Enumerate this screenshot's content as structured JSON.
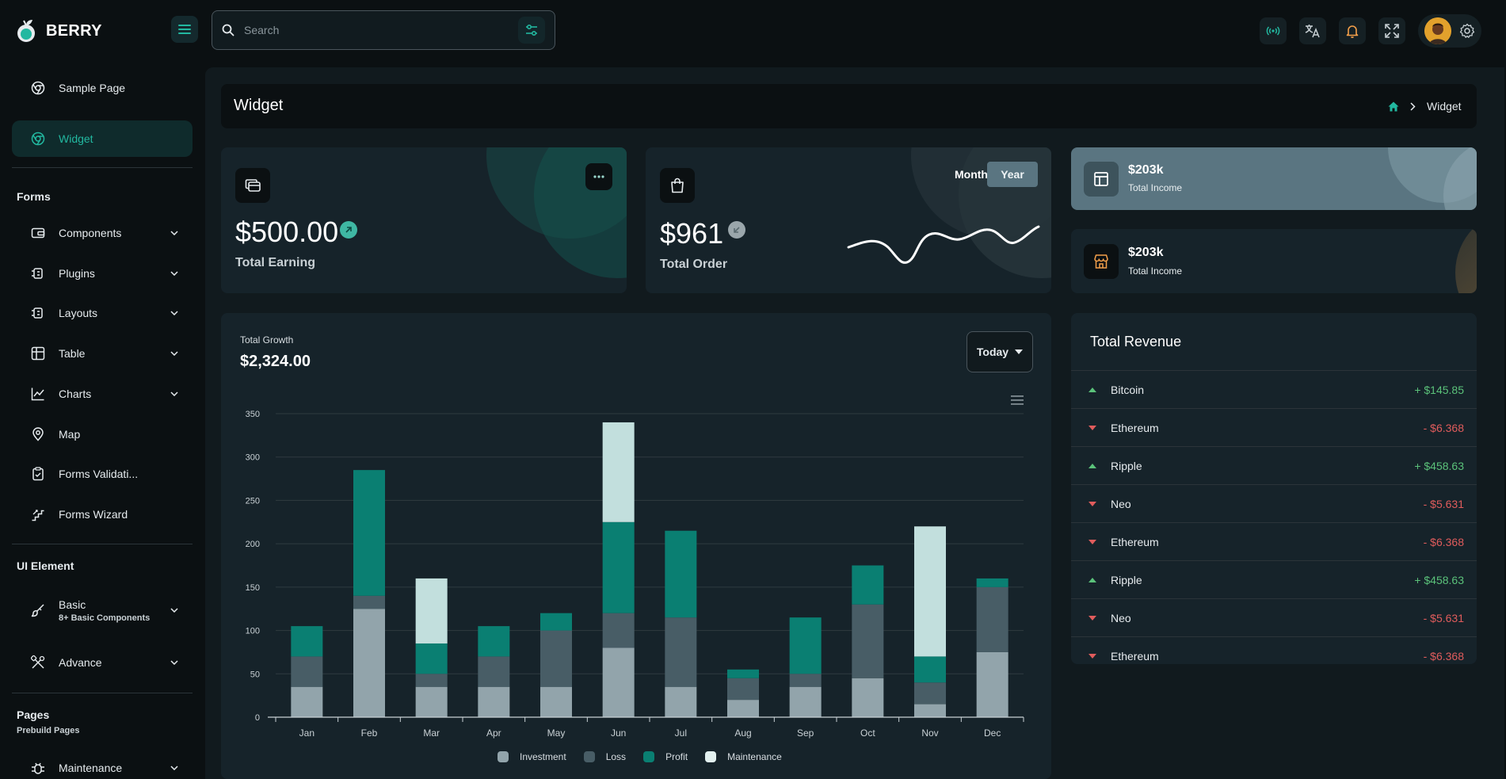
{
  "app": {
    "name": "BERRY"
  },
  "search": {
    "placeholder": "Search"
  },
  "sidebar": {
    "items_top": [
      {
        "label": "Sample Page"
      },
      {
        "label": "Widget"
      }
    ],
    "forms_title": "Forms",
    "forms_items": [
      {
        "label": "Components"
      },
      {
        "label": "Plugins"
      },
      {
        "label": "Layouts"
      },
      {
        "label": "Table"
      },
      {
        "label": "Charts"
      },
      {
        "label": "Map"
      },
      {
        "label": "Forms Validati..."
      },
      {
        "label": "Forms Wizard"
      }
    ],
    "ui_title": "UI Element",
    "basic": {
      "label": "Basic",
      "caption": "8+ Basic Components"
    },
    "advance": {
      "label": "Advance"
    },
    "pages_title": "Pages",
    "pages_caption": "Prebuild Pages",
    "maintenance": {
      "label": "Maintenance"
    }
  },
  "page": {
    "title": "Widget",
    "breadcrumb_current": "Widget"
  },
  "earning": {
    "amount": "$500.00",
    "label": "Total Earning"
  },
  "order": {
    "amount": "$961",
    "label": "Total Order",
    "tab_month": "Month",
    "tab_year": "Year",
    "active_tab": "Year"
  },
  "income_cards": [
    {
      "amount": "$203k",
      "label": "Total Income"
    },
    {
      "amount": "$203k",
      "label": "Total Income"
    }
  ],
  "growth": {
    "caption": "Total Growth",
    "amount": "$2,324.00",
    "period": "Today"
  },
  "revenue": {
    "title": "Total Revenue",
    "rows": [
      {
        "name": "Bitcoin",
        "value": "+ $145.85",
        "trend": "up"
      },
      {
        "name": "Ethereum",
        "value": "- $6.368",
        "trend": "down"
      },
      {
        "name": "Ripple",
        "value": "+ $458.63",
        "trend": "up"
      },
      {
        "name": "Neo",
        "value": "- $5.631",
        "trend": "down"
      },
      {
        "name": "Ethereum",
        "value": "- $6.368",
        "trend": "down"
      },
      {
        "name": "Ripple",
        "value": "+ $458.63",
        "trend": "up"
      },
      {
        "name": "Neo",
        "value": "- $5.631",
        "trend": "down"
      },
      {
        "name": "Ethereum",
        "value": "- $6.368",
        "trend": "down"
      }
    ]
  },
  "colors": {
    "accent": "#22b8a0",
    "investment": "#92a4ab",
    "loss": "#485d66",
    "profit": "#0a7f72",
    "maintenance": "#c2dfdd",
    "up": "#5bc27a",
    "down": "#e05c5c"
  },
  "chart_data": {
    "type": "bar",
    "stacked": true,
    "categories": [
      "Jan",
      "Feb",
      "Mar",
      "Apr",
      "May",
      "Jun",
      "Jul",
      "Aug",
      "Sep",
      "Oct",
      "Nov",
      "Dec"
    ],
    "ylim": [
      0,
      350
    ],
    "yticks": [
      0,
      50,
      100,
      150,
      200,
      250,
      300,
      350
    ],
    "series": [
      {
        "name": "Investment",
        "values": [
          35,
          125,
          35,
          35,
          35,
          80,
          35,
          20,
          35,
          45,
          15,
          75
        ]
      },
      {
        "name": "Loss",
        "values": [
          35,
          15,
          15,
          35,
          65,
          40,
          80,
          25,
          15,
          85,
          25,
          75
        ]
      },
      {
        "name": "Profit",
        "values": [
          35,
          145,
          35,
          35,
          20,
          105,
          100,
          10,
          65,
          45,
          30,
          10
        ]
      },
      {
        "name": "Maintenance",
        "values": [
          0,
          0,
          75,
          0,
          0,
          115,
          0,
          0,
          0,
          0,
          150,
          0
        ]
      }
    ],
    "grid": true,
    "legend": "bottom"
  }
}
